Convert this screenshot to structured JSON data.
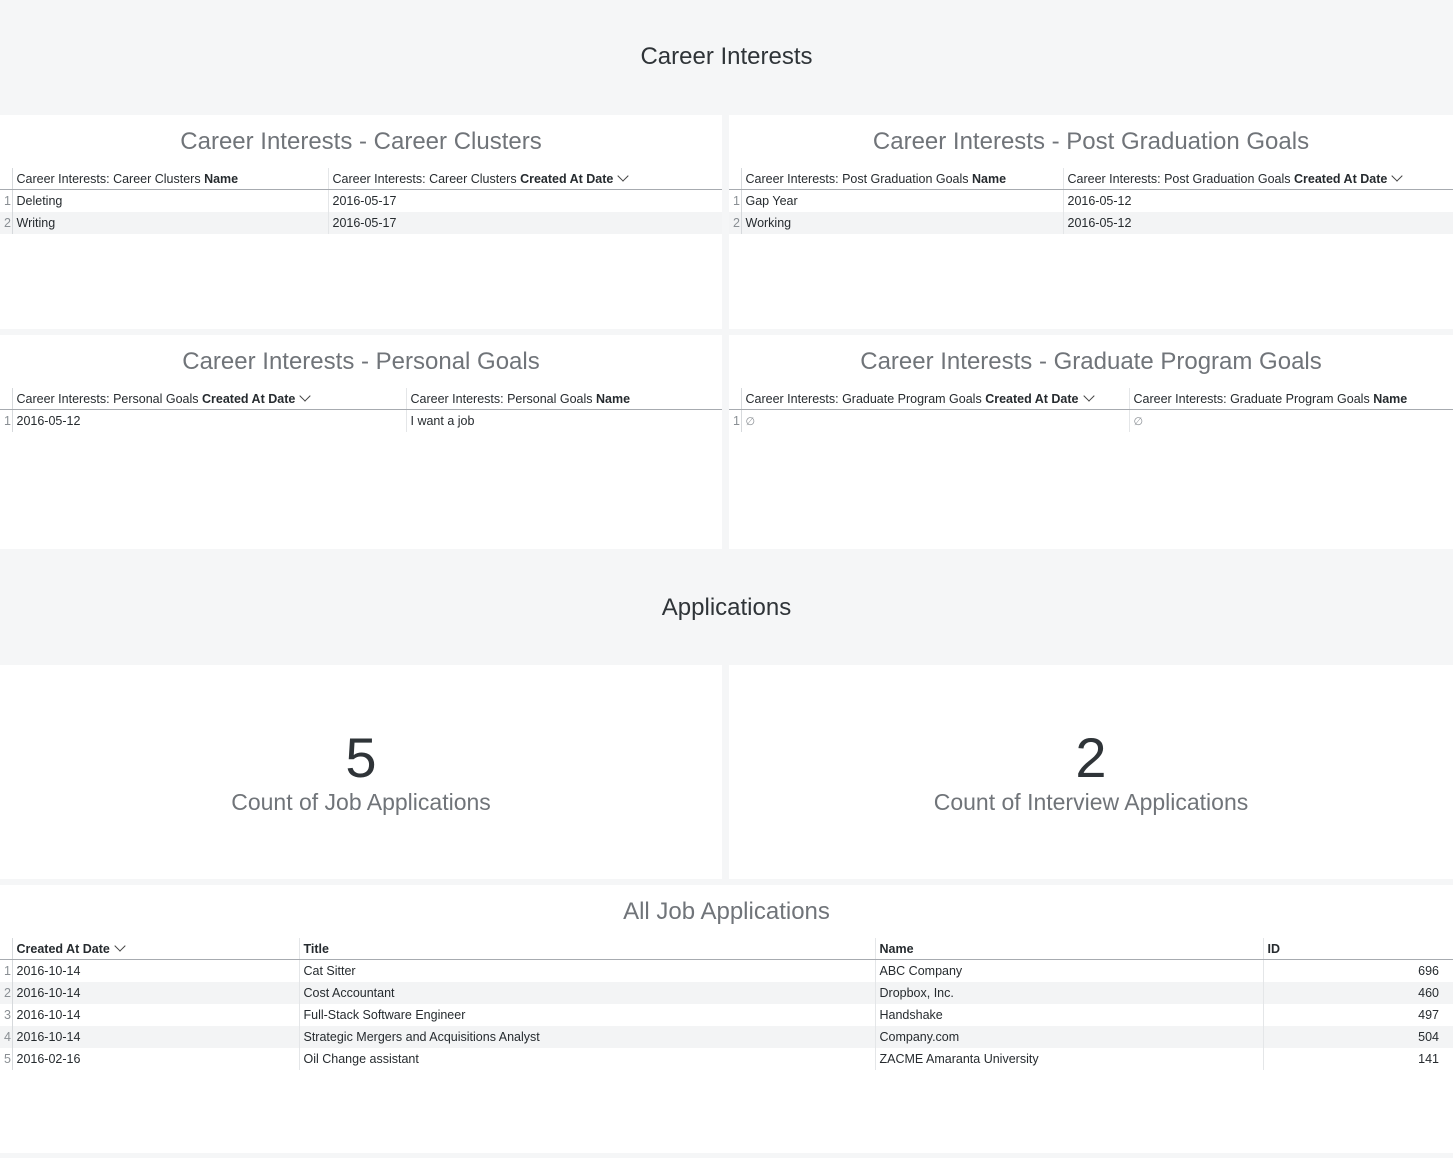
{
  "sections": {
    "career_interests": "Career Interests",
    "applications": "Applications"
  },
  "career_clusters": {
    "title": "Career Interests - Career Clusters",
    "col1_prefix": "Career Interests: Career Clusters ",
    "col1_field": "Name",
    "col2_prefix": "Career Interests: Career Clusters ",
    "col2_field": "Created At Date",
    "rows": [
      {
        "idx": "1",
        "name": "Deleting",
        "date": "2016-05-17"
      },
      {
        "idx": "2",
        "name": "Writing",
        "date": "2016-05-17"
      }
    ]
  },
  "post_grad_goals": {
    "title": "Career Interests - Post Graduation Goals",
    "col1_prefix": "Career Interests: Post Graduation Goals ",
    "col1_field": "Name",
    "col2_prefix": "Career Interests: Post Graduation Goals ",
    "col2_field": "Created At Date",
    "rows": [
      {
        "idx": "1",
        "name": "Gap Year",
        "date": "2016-05-12"
      },
      {
        "idx": "2",
        "name": "Working",
        "date": "2016-05-12"
      }
    ]
  },
  "personal_goals": {
    "title": "Career Interests - Personal Goals",
    "col1_prefix": "Career Interests: Personal Goals ",
    "col1_field": "Created At Date",
    "col2_prefix": "Career Interests: Personal Goals ",
    "col2_field": "Name",
    "rows": [
      {
        "idx": "1",
        "date": "2016-05-12",
        "name": "I want a job"
      }
    ]
  },
  "grad_program_goals": {
    "title": "Career Interests - Graduate Program Goals",
    "col1_prefix": "Career Interests: Graduate Program Goals ",
    "col1_field": "Created At Date",
    "col2_prefix": "Career Interests: Graduate Program Goals ",
    "col2_field": "Name",
    "rows": [
      {
        "idx": "1",
        "date": "∅",
        "name": "∅"
      }
    ]
  },
  "kpis": {
    "job_apps": {
      "value": "5",
      "label": "Count of Job Applications"
    },
    "interview_apps": {
      "value": "2",
      "label": "Count of Interview Applications"
    }
  },
  "all_job_apps": {
    "title": "All Job Applications",
    "headers": {
      "date": "Created At Date",
      "title": "Title",
      "name": "Name",
      "id": "ID"
    },
    "rows": [
      {
        "idx": "1",
        "date": "2016-10-14",
        "title": "Cat Sitter",
        "name": "ABC Company",
        "id": "696"
      },
      {
        "idx": "2",
        "date": "2016-10-14",
        "title": "Cost Accountant",
        "name": "Dropbox, Inc.",
        "id": "460"
      },
      {
        "idx": "3",
        "date": "2016-10-14",
        "title": "Full-Stack Software Engineer",
        "name": "Handshake",
        "id": "497"
      },
      {
        "idx": "4",
        "date": "2016-10-14",
        "title": "Strategic Mergers and Acquisitions Analyst",
        "name": "Company.com",
        "id": "504"
      },
      {
        "idx": "5",
        "date": "2016-02-16",
        "title": "Oil Change assistant",
        "name": "ZACME Amaranta University",
        "id": "141"
      }
    ]
  }
}
